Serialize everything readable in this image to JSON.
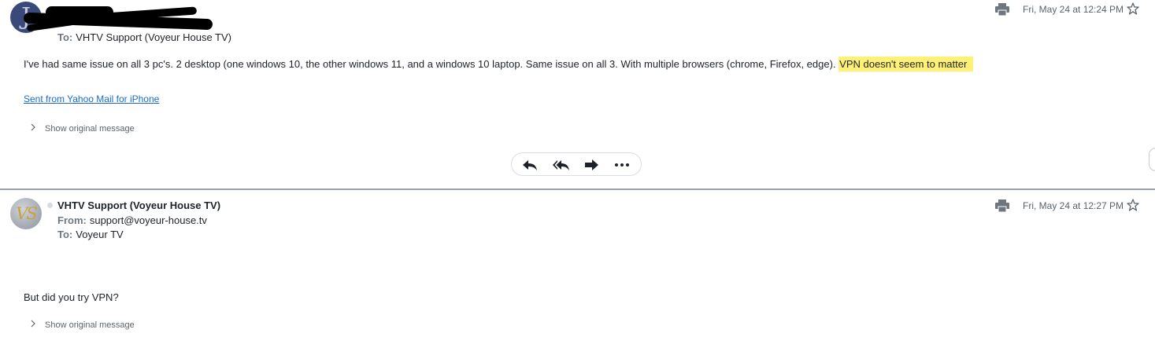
{
  "messages": [
    {
      "avatar_initial": "J",
      "to_label": "To:",
      "to_value": "VHTV Support (Voyeur House TV)",
      "timestamp": "Fri, May 24 at 12:24 PM",
      "body_plain": "I've had same issue on all 3 pc's. 2 desktop (one windows 10, the other windows 11, and a windows 10 laptop. Same issue on all 3. With multiple browsers (chrome, Firefox, edge).",
      "body_highlight": "VPN doesn't seem to matter",
      "signature_link": "Sent from Yahoo Mail for iPhone",
      "show_original": "Show original message"
    },
    {
      "avatar_initial": "VS",
      "sender_name": "VHTV Support (Voyeur House TV)",
      "from_label": "From:",
      "from_value": "support@voyeur-house.tv",
      "to_label": "To:",
      "to_value": "Voyeur TV",
      "timestamp": "Fri, May 24 at 12:27 PM",
      "body": "But did you try VPN?",
      "show_original": "Show original message"
    }
  ],
  "actions": [
    "reply",
    "reply-all",
    "forward",
    "more"
  ],
  "icons": {
    "print": "printer-icon",
    "star": "star-icon",
    "reply": "reply-icon",
    "reply_all": "reply-all-icon",
    "forward": "forward-icon",
    "more": "more-icon",
    "expand": "chevron-right-icon"
  },
  "colors": {
    "highlight": "#fff176",
    "link": "#1b6ad1",
    "header_label": "#6e7780",
    "divider": "#9aa0a6"
  }
}
